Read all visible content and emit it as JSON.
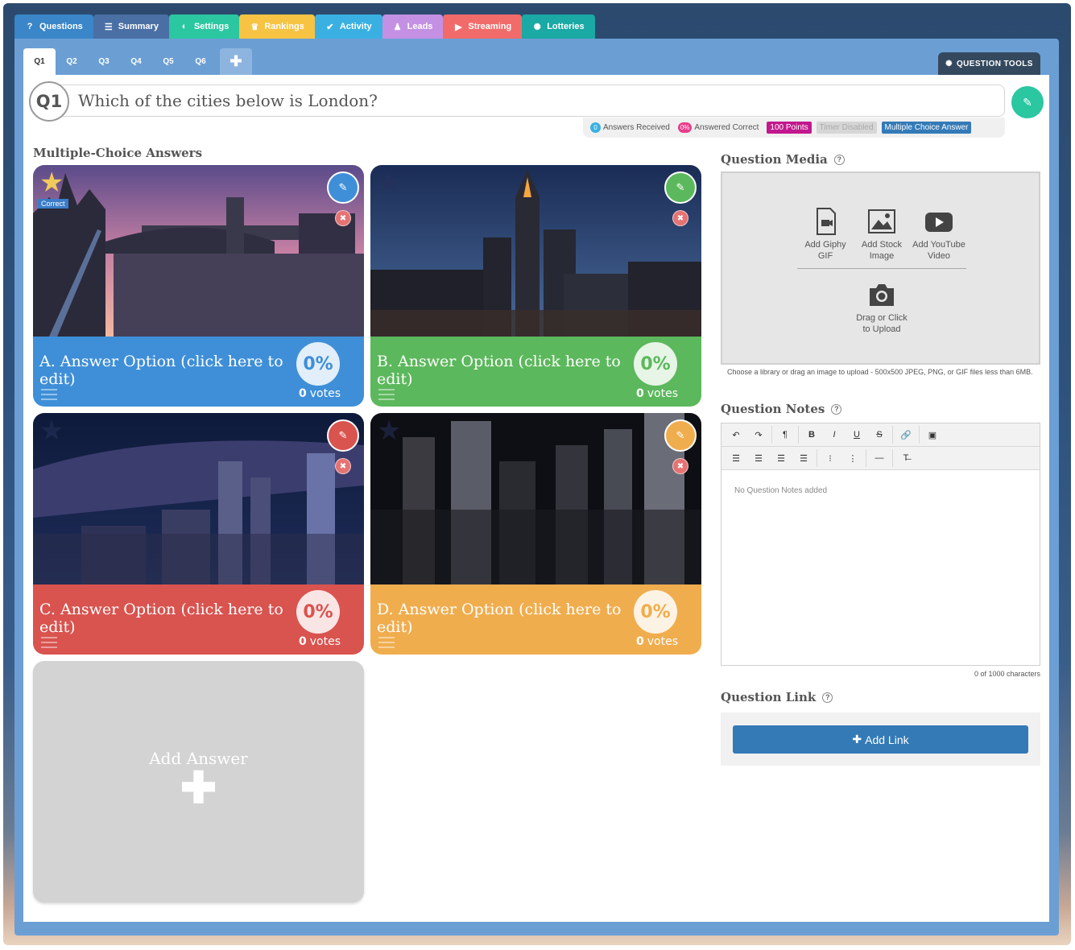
{
  "main_tabs": [
    {
      "label": "Questions",
      "icon": "question-icon",
      "glyph": "?",
      "color": "#3a86c8"
    },
    {
      "label": "Summary",
      "icon": "list-icon",
      "glyph": "☰",
      "color": "#4a6fa5"
    },
    {
      "label": "Settings",
      "icon": "toggle-icon",
      "glyph": "◐",
      "color": "#2ac7a1"
    },
    {
      "label": "Rankings",
      "icon": "trophy-icon",
      "glyph": "♛",
      "color": "#f6c343"
    },
    {
      "label": "Activity",
      "icon": "check-circle-icon",
      "glyph": "✔",
      "color": "#3ab0e2"
    },
    {
      "label": "Leads",
      "icon": "user-icon",
      "glyph": "♟",
      "color": "#c490e4"
    },
    {
      "label": "Streaming",
      "icon": "video-camera-icon",
      "glyph": "▶",
      "color": "#f26b6b"
    },
    {
      "label": "Lotteries",
      "icon": "gear-icon",
      "glyph": "✺",
      "color": "#1aa9a4"
    }
  ],
  "question_tabs": [
    "Q1",
    "Q2",
    "Q3",
    "Q4",
    "Q5",
    "Q6"
  ],
  "question_tools_label": "QUESTION TOOLS",
  "question": {
    "number": "Q1",
    "text": "Which of the cities below is London?"
  },
  "badges": {
    "answers_received_count": "0",
    "answers_received_label": "Answers Received",
    "answered_correct_pct": "0%",
    "answered_correct_label": "Answered Correct",
    "points": "100 Points",
    "timer": "Timer Disabled",
    "type": "Multiple Choice Answer"
  },
  "answers_heading": "Multiple-Choice Answers",
  "answers": [
    {
      "text": "A. Answer Option (click here to edit)",
      "pct": "0%",
      "votes_count": "0",
      "votes_label": "votes",
      "color": "#3f8fd8",
      "correct": true,
      "correct_label": "Correct"
    },
    {
      "text": "B. Answer Option (click here to edit)",
      "pct": "0%",
      "votes_count": "0",
      "votes_label": "votes",
      "color": "#5cb85c",
      "correct": false
    },
    {
      "text": "C. Answer Option (click here to edit)",
      "pct": "0%",
      "votes_count": "0",
      "votes_label": "votes",
      "color": "#d9534f",
      "correct": false
    },
    {
      "text": "D. Answer Option (click here to edit)",
      "pct": "0%",
      "votes_count": "0",
      "votes_label": "votes",
      "color": "#f0ad4e",
      "correct": false
    }
  ],
  "add_answer_label": "Add Answer",
  "media": {
    "heading": "Question Media",
    "gif": "Add Giphy GIF",
    "stock": "Add Stock Image",
    "youtube": "Add YouTube Video",
    "upload": "Drag or Click to Upload",
    "caption": "Choose a library or drag an image to upload - 500x500 JPEG, PNG, or GIF files less than 6MB."
  },
  "notes": {
    "heading": "Question Notes",
    "placeholder": "No Question Notes added",
    "char_count": "0 of 1000 characters"
  },
  "link": {
    "heading": "Question Link",
    "button": "Add Link"
  }
}
